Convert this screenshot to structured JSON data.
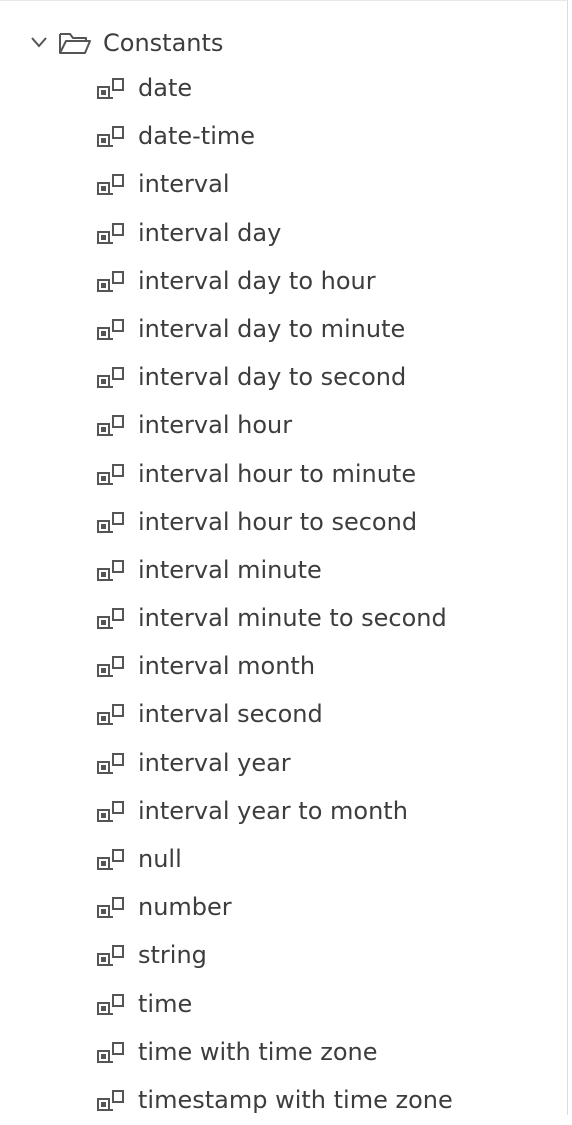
{
  "tree": {
    "folder": {
      "label": "Constants",
      "expanded": true,
      "chevron_icon": "chevron-down-icon",
      "folder_icon": "folder-open-icon"
    },
    "item_icon": "constant-icon",
    "items": [
      {
        "label": "date"
      },
      {
        "label": "date-time"
      },
      {
        "label": "interval"
      },
      {
        "label": "interval day"
      },
      {
        "label": "interval day to hour"
      },
      {
        "label": "interval day to minute"
      },
      {
        "label": "interval day to second"
      },
      {
        "label": "interval hour"
      },
      {
        "label": "interval hour to minute"
      },
      {
        "label": "interval hour to second"
      },
      {
        "label": "interval minute"
      },
      {
        "label": "interval minute to second"
      },
      {
        "label": "interval month"
      },
      {
        "label": "interval second"
      },
      {
        "label": "interval year"
      },
      {
        "label": "interval year to month"
      },
      {
        "label": "null"
      },
      {
        "label": "number"
      },
      {
        "label": "string"
      },
      {
        "label": "time"
      },
      {
        "label": "time with time zone"
      },
      {
        "label": "timestamp with time zone"
      }
    ]
  },
  "colors": {
    "text": "#3d3d3d",
    "icon": "#555555",
    "border": "#dcdcdc"
  }
}
